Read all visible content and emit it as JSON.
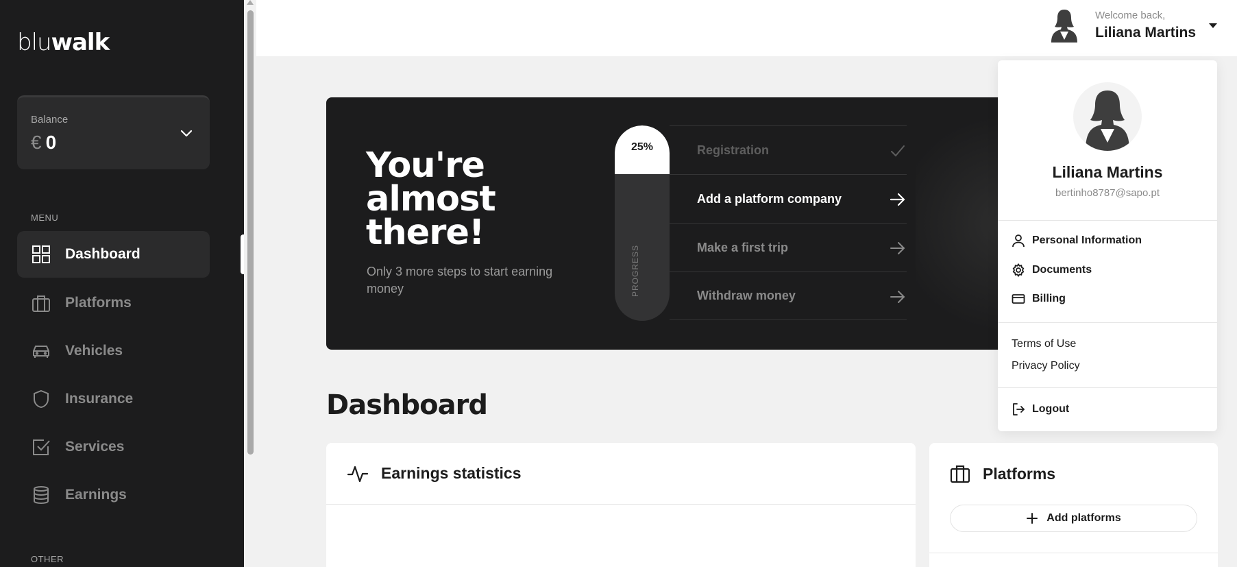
{
  "brand": {
    "logo_text_light": "blu",
    "logo_text_bold": "walk"
  },
  "balance": {
    "label": "Balance",
    "currency": "€",
    "value": "0"
  },
  "sidebar": {
    "menu_label": "MENU",
    "other_label": "OTHER",
    "items": [
      {
        "label": "Dashboard",
        "icon": "grid-icon",
        "active": true
      },
      {
        "label": "Platforms",
        "icon": "briefcase-icon",
        "active": false
      },
      {
        "label": "Vehicles",
        "icon": "car-icon",
        "active": false
      },
      {
        "label": "Insurance",
        "icon": "shield-icon",
        "active": false
      },
      {
        "label": "Services",
        "icon": "checkbox-icon",
        "active": false
      },
      {
        "label": "Earnings",
        "icon": "database-icon",
        "active": false
      }
    ]
  },
  "header": {
    "welcome": "Welcome back,",
    "user_name": "Liliana Martins"
  },
  "hero": {
    "title": "You're almost there!",
    "subtitle": "Only 3 more steps to start earning money",
    "progress_percent_label": "25%",
    "progress_value": 0.25,
    "progress_label": "PROGRESS",
    "steps": [
      {
        "label": "Registration",
        "state": "done",
        "icon": "check-icon"
      },
      {
        "label": "Add a platform company",
        "state": "current",
        "icon": "arrow-right-icon"
      },
      {
        "label": "Make a first trip",
        "state": "pending",
        "icon": "arrow-right-icon"
      },
      {
        "label": "Withdraw money",
        "state": "pending",
        "icon": "arrow-right-icon"
      }
    ]
  },
  "main": {
    "title": "Dashboard",
    "earnings_title": "Earnings statistics",
    "platforms_title": "Platforms",
    "add_platforms_label": "Add platforms"
  },
  "dropdown": {
    "name": "Liliana Martins",
    "email": "bertinho8787@sapo.pt",
    "items": [
      {
        "label": "Personal Information",
        "icon": "user-icon"
      },
      {
        "label": "Documents",
        "icon": "gear-icon"
      },
      {
        "label": "Billing",
        "icon": "credit-card-icon"
      }
    ],
    "links": [
      "Terms of Use",
      "Privacy Policy"
    ],
    "logout_label": "Logout"
  }
}
